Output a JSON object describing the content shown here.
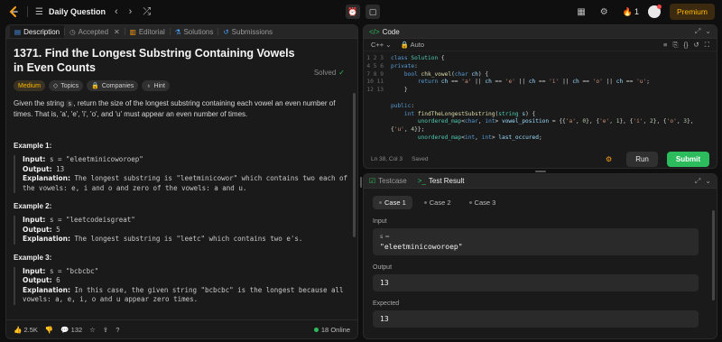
{
  "topbar": {
    "title": "Daily Question",
    "streak": "1",
    "premium": "Premium"
  },
  "problem_tabs": [
    {
      "label": "Description"
    },
    {
      "label": "Accepted"
    },
    {
      "label": "Editorial"
    },
    {
      "label": "Solutions"
    },
    {
      "label": "Submissions"
    }
  ],
  "problem": {
    "title": "1371. Find the Longest Substring Containing Vowels in Even Counts",
    "status": "Solved",
    "difficulty": "Medium",
    "chips": [
      "Topics",
      "Companies",
      "Hint"
    ],
    "desc_pre": "Given the string ",
    "desc_var": "s",
    "desc_post": ", return the size of the longest substring containing each vowel an even number of times. That is, 'a', 'e', 'i', 'o', and 'u' must appear an even number of times."
  },
  "examples": [
    {
      "heading": "Example 1:",
      "input": "s = \"eleetminicoworoep\"",
      "output": "13",
      "explanation": "The longest substring is \"leetminicowor\" which contains two each of the vowels: e, i and o and zero of the vowels: a and u."
    },
    {
      "heading": "Example 2:",
      "input": "s = \"leetcodeisgreat\"",
      "output": "5",
      "explanation": "The longest substring is \"leetc\" which contains two e's."
    },
    {
      "heading": "Example 3:",
      "input": "s = \"bcbcbc\"",
      "output": "6",
      "explanation": "In this case, the given string \"bcbcbc\" is the longest because all vowels: a, e, i, o and u appear zero times."
    }
  ],
  "labels": {
    "input": "Input:",
    "output": "Output:",
    "explanation": "Explanation:"
  },
  "bottom": {
    "likes": "2.5K",
    "comments": "132",
    "online": "18 Online"
  },
  "code": {
    "tab": "Code",
    "language": "C++",
    "mode": "Auto",
    "status": "Ln 38, Col 3",
    "saved": "Saved",
    "run": "Run",
    "submit": "Submit"
  },
  "test": {
    "tab_testcase": "Testcase",
    "tab_result": "Test Result",
    "cases": [
      "Case 1",
      "Case 2",
      "Case 3"
    ],
    "input_label": "Input",
    "var": "s =",
    "input_value": "\"eleetminicoworoep\"",
    "output_label": "Output",
    "output_value": "13",
    "expected_label": "Expected",
    "expected_value": "13"
  }
}
